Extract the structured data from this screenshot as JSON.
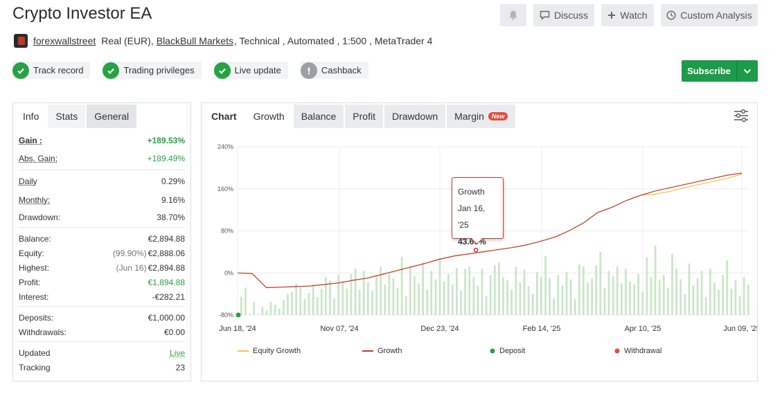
{
  "header": {
    "title": "Crypto Investor EA",
    "bell_label": "",
    "discuss_label": "Discuss",
    "watch_label": "Watch",
    "custom_label": "Custom Analysis"
  },
  "meta": {
    "username": "forexwallstreet",
    "account_type": "Real (EUR),",
    "broker": "BlackBull Markets",
    "rest": ", Technical , Automated , 1:500 , MetaTrader 4"
  },
  "badges": [
    {
      "label": "Track record",
      "icon": "check-icon"
    },
    {
      "label": "Trading privileges",
      "icon": "check-icon"
    },
    {
      "label": "Live update",
      "icon": "check-icon"
    },
    {
      "label": "Cashback",
      "icon": "exclamation-icon"
    }
  ],
  "subscribe_label": "Subscribe",
  "left_tabs": [
    "Info",
    "Stats",
    "General"
  ],
  "stats": {
    "gain_k": "Gain :",
    "gain_v": "+189.53%",
    "abs_k": "Abs. Gain:",
    "abs_v": "+189.49%",
    "daily_k": "Daily",
    "daily_v": "0.29%",
    "monthly_k": "Monthly:",
    "monthly_v": "9.16%",
    "dd_k": "Drawdown:",
    "dd_v": "38.70%",
    "bal_k": "Balance:",
    "bal_v": "€2,894.88",
    "eq_k": "Equity:",
    "eq_sub": "(99.90%)",
    "eq_v": "€2,888.06",
    "hi_k": "Highest:",
    "hi_sub": "(Jun 16)",
    "hi_v": "€2,894.88",
    "profit_k": "Profit:",
    "profit_v": "€1,894.88",
    "int_k": "Interest:",
    "int_v": "-€282.21",
    "dep_k": "Deposits:",
    "dep_v": "€1,000.00",
    "wd_k": "Withdrawals:",
    "wd_v": "€0.00",
    "upd_k": "Updated",
    "upd_v": "Live",
    "trk_k": "Tracking",
    "trk_v": "23"
  },
  "chart_tabs": {
    "chart": "Chart",
    "growth": "Growth",
    "balance": "Balance",
    "profit": "Profit",
    "drawdown": "Drawdown",
    "margin": "Margin",
    "new": "New"
  },
  "colors": {
    "growth_line": "#c0392b",
    "equity_line": "#f5c242",
    "bars": "#c9e6c6",
    "deposit": "#27a243",
    "withdrawal": "#e74c3c",
    "accent_green": "#1d9a4a"
  },
  "tooltip": {
    "title": "Growth",
    "date": "Jan 16, '25",
    "value": "43.69%"
  },
  "legend": {
    "equity": "Equity Growth",
    "growth": "Growth",
    "deposit": "Deposit",
    "withdrawal": "Withdrawal"
  },
  "chart_data": {
    "type": "line",
    "ylim": [
      -80,
      240
    ],
    "yticks": [
      "240%",
      "160%",
      "80%",
      "0%",
      "-80%"
    ],
    "xticks": [
      "Jun 18, '24",
      "Nov 07, '24",
      "Dec 23, '24",
      "Feb 14, '25",
      "Apr 10, '25",
      "Jun 09, '25"
    ],
    "series": [
      {
        "name": "Growth",
        "values": [
          0,
          -1,
          -28,
          -27,
          -26,
          -25,
          -22,
          -19,
          -14,
          -10,
          -3,
          4,
          11,
          18,
          26,
          32,
          36,
          40,
          44,
          48,
          53,
          60,
          68,
          80,
          95,
          115,
          125,
          138,
          148,
          156,
          162,
          168,
          174,
          180,
          186,
          190
        ]
      },
      {
        "name": "Equity Growth",
        "values": [
          0,
          -1,
          -28,
          -27,
          -26,
          -25,
          -22,
          -19,
          -14,
          -10,
          -3,
          4,
          11,
          18,
          26,
          32,
          36,
          40,
          44,
          48,
          53,
          60,
          68,
          80,
          95,
          115,
          125,
          138,
          148,
          150,
          155,
          162,
          168,
          174,
          180,
          188
        ]
      }
    ],
    "bars": [
      -45,
      -28,
      -78,
      -55,
      -78,
      -65,
      -72,
      -55,
      -60,
      -68,
      -52,
      -40,
      -36,
      -20,
      -28,
      -50,
      -38,
      -22,
      -46,
      -30,
      -8,
      -14,
      -48,
      -4,
      -16,
      -30,
      -2,
      8,
      -32,
      4,
      -18,
      -34,
      -6,
      12,
      -22,
      -2,
      -10,
      -28,
      30,
      -44,
      14,
      -6,
      -20,
      20,
      -32,
      4,
      -12,
      28,
      -16,
      -2,
      -22,
      10,
      -34,
      8,
      12,
      -8,
      -24,
      8,
      -44,
      -4,
      14,
      20,
      -8,
      -14,
      -32,
      12,
      -18,
      6,
      -26,
      -40,
      2,
      -8,
      32,
      -10,
      -48,
      -4,
      -24,
      2,
      -12,
      -50,
      16,
      12,
      -18,
      -10,
      14,
      40,
      -28,
      4,
      -6,
      12,
      -20,
      8,
      -16,
      -22,
      -2,
      -36,
      30,
      -8,
      52,
      -14,
      -4,
      -28,
      36,
      8,
      -12,
      -40,
      18,
      -24,
      -10,
      4,
      -46,
      8,
      -18,
      -32,
      -4,
      24,
      -30,
      -14,
      -44,
      -8,
      -22
    ],
    "markers": [
      {
        "type": "Deposit",
        "x": "Jun 18, '24",
        "y": -80
      }
    ]
  }
}
